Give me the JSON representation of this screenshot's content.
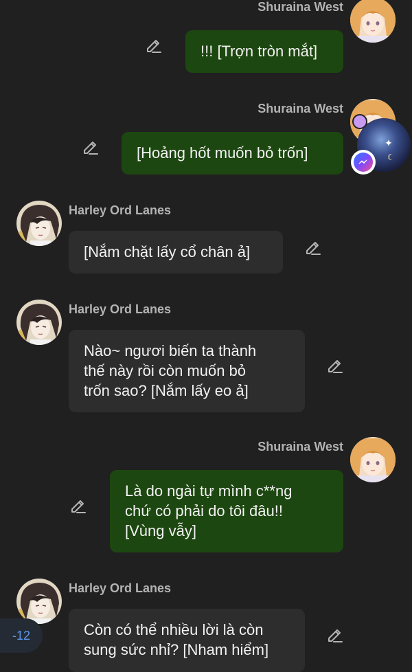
{
  "colors": {
    "background": "#202020",
    "outgoing_bubble": "#1d4710",
    "incoming_bubble": "#2d2d2d",
    "name_text": "#b3b3b3",
    "count_text": "#5b97e8"
  },
  "messages": [
    {
      "sender": "Shuraina West",
      "direction": "outgoing",
      "lines": [
        "!!! [Trợn tròn mắt]"
      ]
    },
    {
      "sender": "Shuraina West",
      "direction": "outgoing",
      "lines": [
        "[Hoảng hốt muốn bỏ trốn]"
      ]
    },
    {
      "sender": "Harley Ord Lanes",
      "direction": "incoming",
      "lines": [
        "[Nắm chặt lấy cổ chân ả]"
      ]
    },
    {
      "sender": "Harley Ord Lanes",
      "direction": "incoming",
      "lines": [
        "Nào~ ngươi biến ta thành",
        "thế này rồi còn muốn bỏ",
        "trốn sao? [Nắm lấy eo ả]"
      ]
    },
    {
      "sender": "Shuraina West",
      "direction": "outgoing",
      "lines": [
        "Là do ngài tự mình c**ng",
        "chứ có phải do tôi đâu!!",
        "[Vùng vẫy]"
      ]
    },
    {
      "sender": "Harley Ord Lanes",
      "direction": "incoming",
      "lines": [
        "Còn có thể nhiều lời là còn",
        "sung sức nhỉ? [Nham hiểm]"
      ]
    }
  ],
  "overlays": {
    "chat_head": "messenger-chat-head",
    "messenger_badge_icon": "messenger-icon",
    "count_badge": "-12"
  },
  "icons": {
    "edit": "pencil-edit-icon"
  }
}
